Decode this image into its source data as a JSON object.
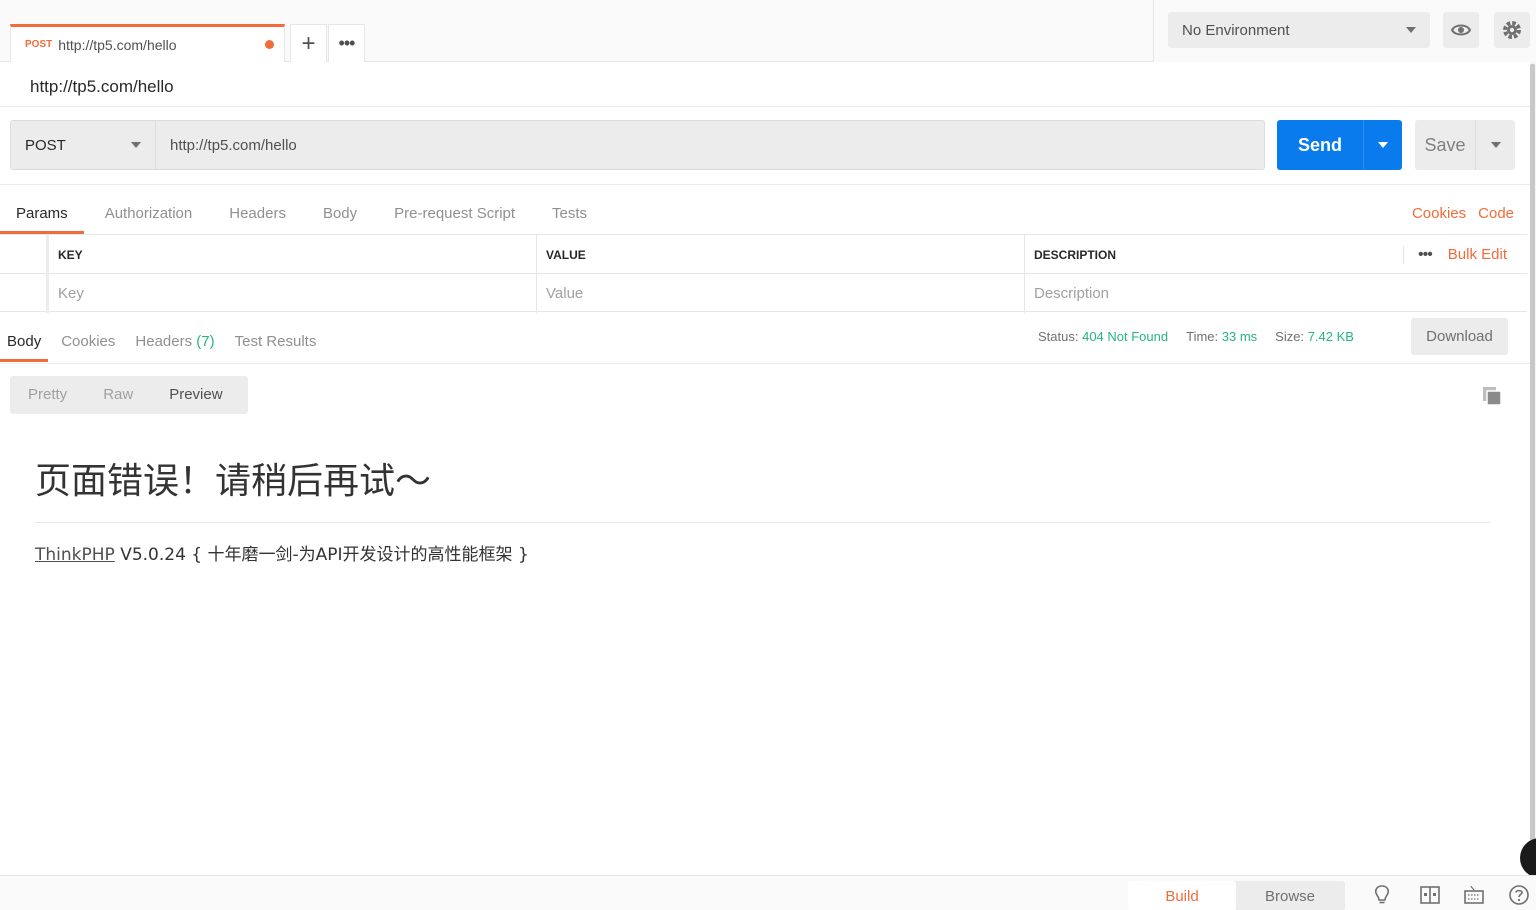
{
  "tabbar": {
    "tab": {
      "method": "POST",
      "url": "http://tp5.com/hello"
    },
    "new_tab_label": "+",
    "more_label": "•••",
    "environment": "No Environment"
  },
  "request": {
    "name": "http://tp5.com/hello",
    "method": "POST",
    "url": "http://tp5.com/hello",
    "send_label": "Send",
    "save_label": "Save"
  },
  "request_tabs": [
    {
      "label": "Params",
      "active": true
    },
    {
      "label": "Authorization"
    },
    {
      "label": "Headers"
    },
    {
      "label": "Body"
    },
    {
      "label": "Pre-request Script"
    },
    {
      "label": "Tests"
    }
  ],
  "request_links": {
    "cookies": "Cookies",
    "code": "Code"
  },
  "params": {
    "columns": [
      "KEY",
      "VALUE",
      "DESCRIPTION"
    ],
    "placeholders": {
      "key": "Key",
      "value": "Value",
      "description": "Description"
    },
    "more_label": "•••",
    "bulk_edit": "Bulk Edit"
  },
  "response_tabs": [
    {
      "label": "Body",
      "active": true
    },
    {
      "label": "Cookies"
    },
    {
      "label": "Headers",
      "count": "(7)"
    },
    {
      "label": "Test Results"
    }
  ],
  "response_meta": {
    "status_label": "Status:",
    "status_value": "404 Not Found",
    "time_label": "Time:",
    "time_value": "33 ms",
    "size_label": "Size:",
    "size_value": "7.42 KB",
    "download_label": "Download"
  },
  "view_modes": [
    {
      "label": "Pretty"
    },
    {
      "label": "Raw"
    },
    {
      "label": "Preview",
      "active": true
    }
  ],
  "preview": {
    "title": "页面错误！请稍后再试～",
    "link": "ThinkPHP",
    "footer_text": " V5.0.24 { 十年磨一剑-为API开发设计的高性能框架 }"
  },
  "statusbar": {
    "build": "Build",
    "browse": "Browse"
  },
  "colors": {
    "accent": "#f26b3a",
    "send": "#097bed",
    "success": "#26b47f"
  }
}
